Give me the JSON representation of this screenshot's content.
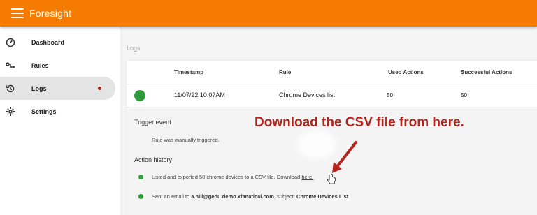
{
  "app": {
    "title": "Foresight"
  },
  "sidebar": {
    "items": [
      {
        "label": "Dashboard",
        "icon": "dashboard-icon"
      },
      {
        "label": "Rules",
        "icon": "rules-icon"
      },
      {
        "label": "Logs",
        "icon": "history-icon",
        "active": true
      },
      {
        "label": "Settings",
        "icon": "gear-icon"
      }
    ]
  },
  "main": {
    "heading": "Logs",
    "table": {
      "columns": [
        "Timestamp",
        "Rule",
        "Used Actions",
        "Successful Actions"
      ],
      "rows": [
        {
          "status": "success",
          "timestamp": "11/07/22 10:07AM",
          "rule": "Chrome Devices list",
          "used_actions": "50",
          "successful_actions": "50"
        }
      ]
    },
    "details": {
      "trigger_title": "Trigger event",
      "trigger_text": "Rule was manually triggered.",
      "history_title": "Action history",
      "history": [
        {
          "text": "Listed and exported 50 chrome devices to a CSV file. Download",
          "link": "here."
        },
        {
          "text_prefix": "Sent an email to",
          "email": "a.hill@gedu.demo.xfanatical.com",
          "text_mid": ", subject:",
          "subject": "Chrome Devices List"
        }
      ]
    }
  },
  "annotation": {
    "text": "Download the CSV file from here."
  },
  "colors": {
    "topbar": "#f57c00",
    "status_green": "#2e9a3c",
    "annotation_red": "#b3241d",
    "active_dot": "#a3201b"
  }
}
